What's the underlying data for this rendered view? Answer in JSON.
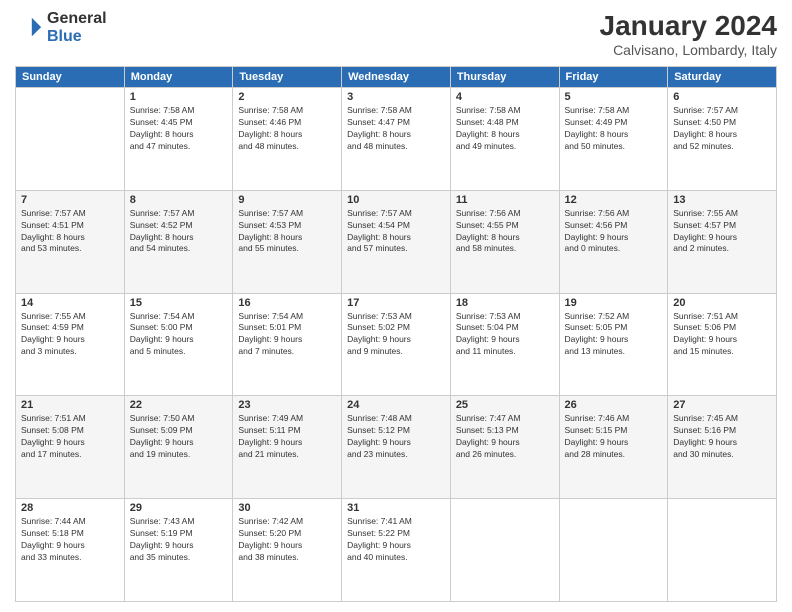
{
  "logo": {
    "line1": "General",
    "line2": "Blue"
  },
  "title": {
    "month_year": "January 2024",
    "location": "Calvisano, Lombardy, Italy"
  },
  "days_of_week": [
    "Sunday",
    "Monday",
    "Tuesday",
    "Wednesday",
    "Thursday",
    "Friday",
    "Saturday"
  ],
  "weeks": [
    [
      {
        "day": "",
        "info": ""
      },
      {
        "day": "1",
        "info": "Sunrise: 7:58 AM\nSunset: 4:45 PM\nDaylight: 8 hours\nand 47 minutes."
      },
      {
        "day": "2",
        "info": "Sunrise: 7:58 AM\nSunset: 4:46 PM\nDaylight: 8 hours\nand 48 minutes."
      },
      {
        "day": "3",
        "info": "Sunrise: 7:58 AM\nSunset: 4:47 PM\nDaylight: 8 hours\nand 48 minutes."
      },
      {
        "day": "4",
        "info": "Sunrise: 7:58 AM\nSunset: 4:48 PM\nDaylight: 8 hours\nand 49 minutes."
      },
      {
        "day": "5",
        "info": "Sunrise: 7:58 AM\nSunset: 4:49 PM\nDaylight: 8 hours\nand 50 minutes."
      },
      {
        "day": "6",
        "info": "Sunrise: 7:57 AM\nSunset: 4:50 PM\nDaylight: 8 hours\nand 52 minutes."
      }
    ],
    [
      {
        "day": "7",
        "info": "Sunrise: 7:57 AM\nSunset: 4:51 PM\nDaylight: 8 hours\nand 53 minutes."
      },
      {
        "day": "8",
        "info": "Sunrise: 7:57 AM\nSunset: 4:52 PM\nDaylight: 8 hours\nand 54 minutes."
      },
      {
        "day": "9",
        "info": "Sunrise: 7:57 AM\nSunset: 4:53 PM\nDaylight: 8 hours\nand 55 minutes."
      },
      {
        "day": "10",
        "info": "Sunrise: 7:57 AM\nSunset: 4:54 PM\nDaylight: 8 hours\nand 57 minutes."
      },
      {
        "day": "11",
        "info": "Sunrise: 7:56 AM\nSunset: 4:55 PM\nDaylight: 8 hours\nand 58 minutes."
      },
      {
        "day": "12",
        "info": "Sunrise: 7:56 AM\nSunset: 4:56 PM\nDaylight: 9 hours\nand 0 minutes."
      },
      {
        "day": "13",
        "info": "Sunrise: 7:55 AM\nSunset: 4:57 PM\nDaylight: 9 hours\nand 2 minutes."
      }
    ],
    [
      {
        "day": "14",
        "info": "Sunrise: 7:55 AM\nSunset: 4:59 PM\nDaylight: 9 hours\nand 3 minutes."
      },
      {
        "day": "15",
        "info": "Sunrise: 7:54 AM\nSunset: 5:00 PM\nDaylight: 9 hours\nand 5 minutes."
      },
      {
        "day": "16",
        "info": "Sunrise: 7:54 AM\nSunset: 5:01 PM\nDaylight: 9 hours\nand 7 minutes."
      },
      {
        "day": "17",
        "info": "Sunrise: 7:53 AM\nSunset: 5:02 PM\nDaylight: 9 hours\nand 9 minutes."
      },
      {
        "day": "18",
        "info": "Sunrise: 7:53 AM\nSunset: 5:04 PM\nDaylight: 9 hours\nand 11 minutes."
      },
      {
        "day": "19",
        "info": "Sunrise: 7:52 AM\nSunset: 5:05 PM\nDaylight: 9 hours\nand 13 minutes."
      },
      {
        "day": "20",
        "info": "Sunrise: 7:51 AM\nSunset: 5:06 PM\nDaylight: 9 hours\nand 15 minutes."
      }
    ],
    [
      {
        "day": "21",
        "info": "Sunrise: 7:51 AM\nSunset: 5:08 PM\nDaylight: 9 hours\nand 17 minutes."
      },
      {
        "day": "22",
        "info": "Sunrise: 7:50 AM\nSunset: 5:09 PM\nDaylight: 9 hours\nand 19 minutes."
      },
      {
        "day": "23",
        "info": "Sunrise: 7:49 AM\nSunset: 5:11 PM\nDaylight: 9 hours\nand 21 minutes."
      },
      {
        "day": "24",
        "info": "Sunrise: 7:48 AM\nSunset: 5:12 PM\nDaylight: 9 hours\nand 23 minutes."
      },
      {
        "day": "25",
        "info": "Sunrise: 7:47 AM\nSunset: 5:13 PM\nDaylight: 9 hours\nand 26 minutes."
      },
      {
        "day": "26",
        "info": "Sunrise: 7:46 AM\nSunset: 5:15 PM\nDaylight: 9 hours\nand 28 minutes."
      },
      {
        "day": "27",
        "info": "Sunrise: 7:45 AM\nSunset: 5:16 PM\nDaylight: 9 hours\nand 30 minutes."
      }
    ],
    [
      {
        "day": "28",
        "info": "Sunrise: 7:44 AM\nSunset: 5:18 PM\nDaylight: 9 hours\nand 33 minutes."
      },
      {
        "day": "29",
        "info": "Sunrise: 7:43 AM\nSunset: 5:19 PM\nDaylight: 9 hours\nand 35 minutes."
      },
      {
        "day": "30",
        "info": "Sunrise: 7:42 AM\nSunset: 5:20 PM\nDaylight: 9 hours\nand 38 minutes."
      },
      {
        "day": "31",
        "info": "Sunrise: 7:41 AM\nSunset: 5:22 PM\nDaylight: 9 hours\nand 40 minutes."
      },
      {
        "day": "",
        "info": ""
      },
      {
        "day": "",
        "info": ""
      },
      {
        "day": "",
        "info": ""
      }
    ]
  ]
}
